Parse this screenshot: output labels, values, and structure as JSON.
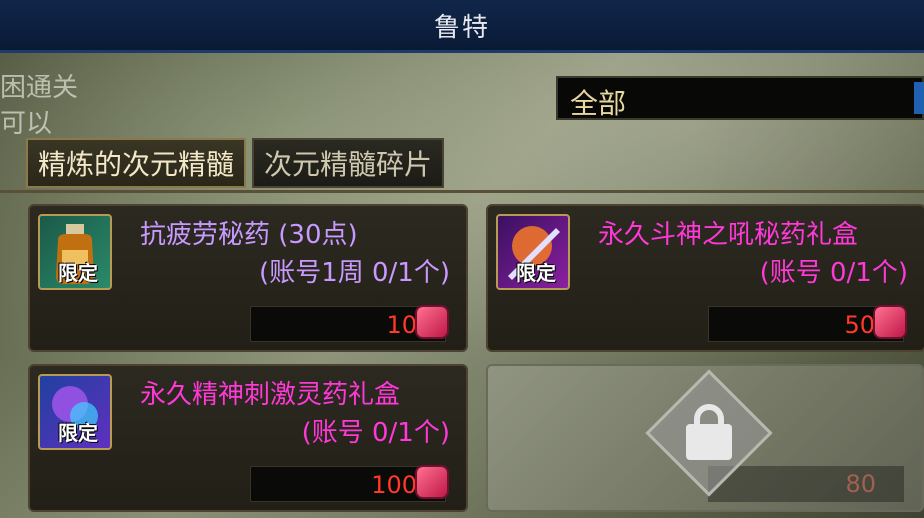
{
  "window": {
    "title": "鲁特"
  },
  "background_fragment": [
    "困通关",
    "可以"
  ],
  "filter": {
    "selected": "全部"
  },
  "tabs": [
    {
      "label": "精炼的次元精髓",
      "active": true
    },
    {
      "label": "次元精髓碎片",
      "active": false
    }
  ],
  "items": [
    {
      "name": "抗疲劳秘药 (30点)",
      "sub": "(账号1周 0/1个)",
      "badge": "限定",
      "price": "10",
      "name_color": "#c89aff",
      "icon": "potion-bottle-icon"
    },
    {
      "name": "永久斗神之吼秘药礼盒",
      "sub": "(账号 0/1个)",
      "badge": "限定",
      "price": "50",
      "name_color": "#ff38d8",
      "icon": "sword-box-icon"
    },
    {
      "name": "永久精神刺激灵药礼盒",
      "sub": "(账号 0/1个)",
      "badge": "限定",
      "price": "100",
      "name_color": "#ff38d8",
      "icon": "spirit-box-icon"
    },
    {
      "name": "",
      "sub": "",
      "badge": "",
      "price": "80",
      "locked": true,
      "icon": "lock-icon"
    }
  ],
  "colors": {
    "title_bar": "#10264a",
    "price": "#ff3a28",
    "accent_gold": "#b89a52"
  }
}
